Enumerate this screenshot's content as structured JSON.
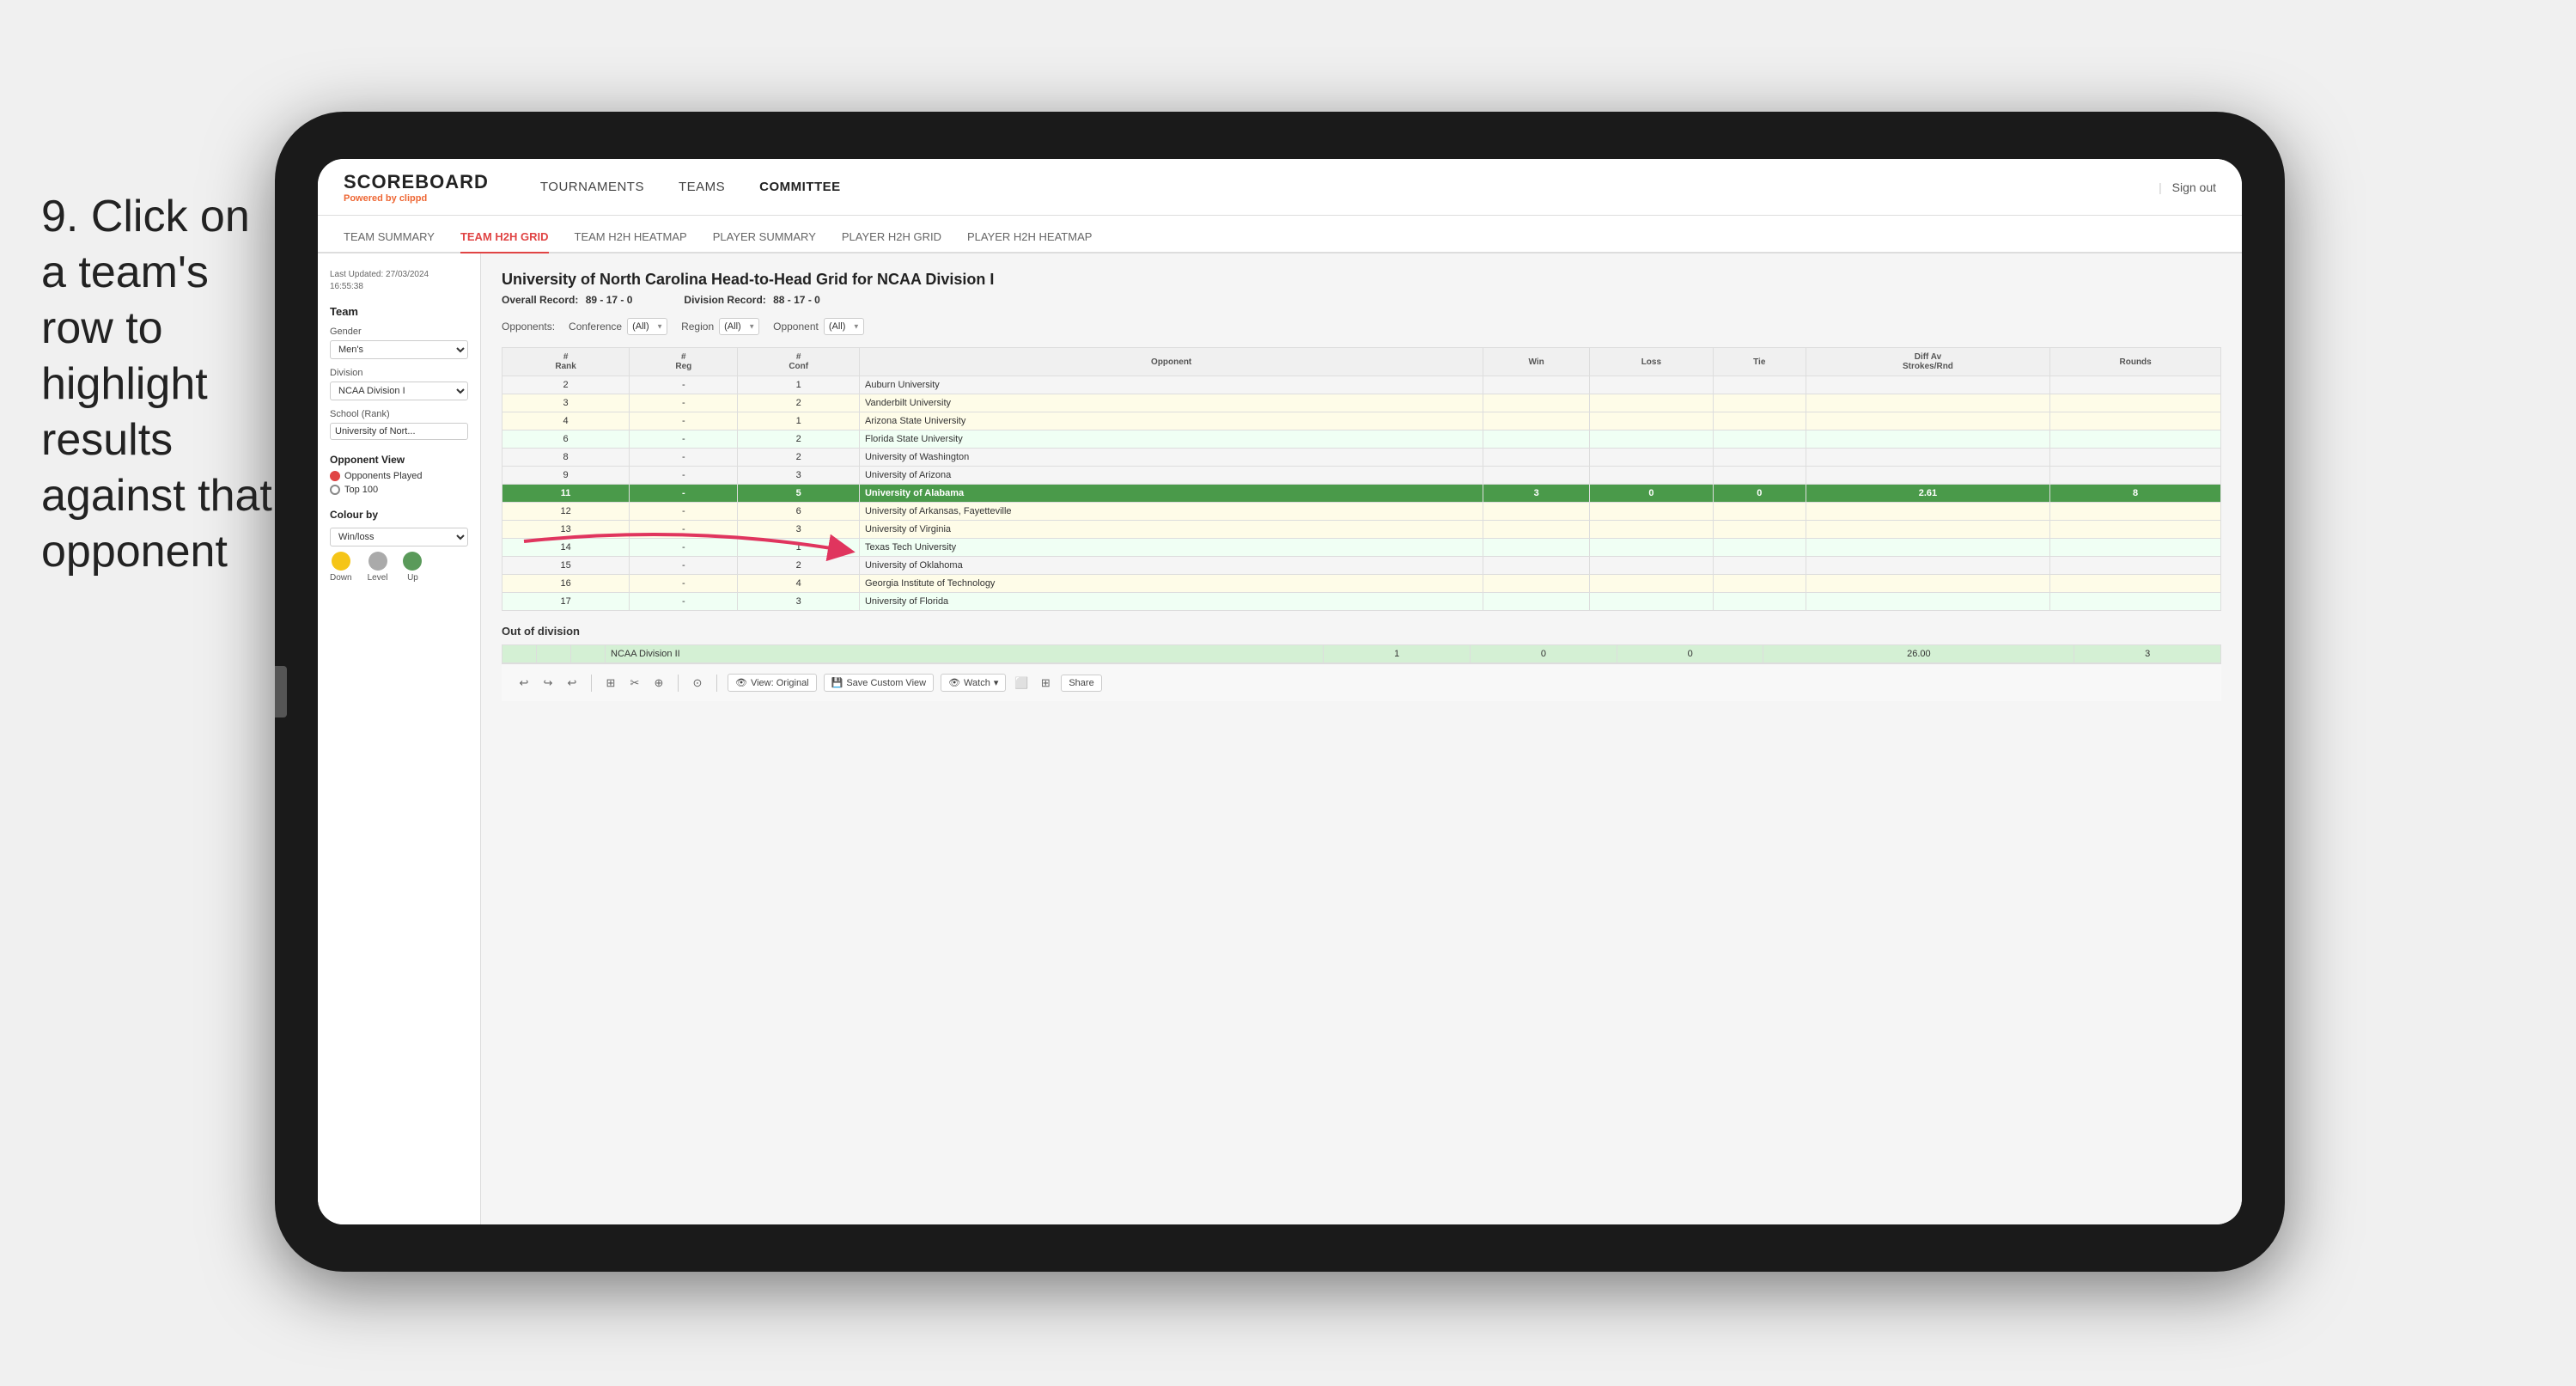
{
  "instruction": {
    "step": "9.",
    "text": "Click on a team's row to highlight results against that opponent"
  },
  "app": {
    "logo": "SCOREBOARD",
    "logo_sub": "Powered by",
    "logo_brand": "clippd",
    "nav_links": [
      "TOURNAMENTS",
      "TEAMS",
      "COMMITTEE"
    ],
    "sign_out": "Sign out"
  },
  "sub_tabs": [
    "TEAM SUMMARY",
    "TEAM H2H GRID",
    "TEAM H2H HEATMAP",
    "PLAYER SUMMARY",
    "PLAYER H2H GRID",
    "PLAYER H2H HEATMAP"
  ],
  "active_sub_tab": "TEAM H2H GRID",
  "sidebar": {
    "timestamp_label": "Last Updated: 27/03/2024",
    "timestamp_time": "16:55:38",
    "team_label": "Team",
    "gender_label": "Gender",
    "gender_value": "Men's",
    "division_label": "Division",
    "division_value": "NCAA Division I",
    "school_label": "School (Rank)",
    "school_value": "University of Nort...",
    "opponent_view_label": "Opponent View",
    "opponents_played_label": "Opponents Played",
    "top100_label": "Top 100",
    "colour_by_label": "Colour by",
    "colour_by_value": "Win/loss",
    "legend": [
      {
        "label": "Down",
        "color": "yellow"
      },
      {
        "label": "Level",
        "color": "gray"
      },
      {
        "label": "Up",
        "color": "green"
      }
    ]
  },
  "panel": {
    "title": "University of North Carolina Head-to-Head Grid for NCAA Division I",
    "overall_record_label": "Overall Record:",
    "overall_record": "89 - 17 - 0",
    "division_record_label": "Division Record:",
    "division_record": "88 - 17 - 0",
    "filters": {
      "opponents_label": "Opponents:",
      "conference_label": "Conference",
      "conference_value": "(All)",
      "region_label": "Region",
      "region_value": "(All)",
      "opponent_label": "Opponent",
      "opponent_value": "(All)"
    },
    "table_headers": [
      "#\nRank",
      "#\nReg",
      "#\nConf",
      "Opponent",
      "Win",
      "Loss",
      "Tie",
      "Diff Av\nStrokes/Rnd",
      "Rounds"
    ],
    "rows": [
      {
        "rank": "2",
        "reg": "-",
        "conf": "1",
        "opponent": "Auburn University",
        "win": "",
        "loss": "",
        "tie": "",
        "diff": "",
        "rounds": "",
        "style": "plain"
      },
      {
        "rank": "3",
        "reg": "-",
        "conf": "2",
        "opponent": "Vanderbilt University",
        "win": "",
        "loss": "",
        "tie": "",
        "diff": "",
        "rounds": "",
        "style": "light-yellow"
      },
      {
        "rank": "4",
        "reg": "-",
        "conf": "1",
        "opponent": "Arizona State University",
        "win": "",
        "loss": "",
        "tie": "",
        "diff": "",
        "rounds": "",
        "style": "light-yellow"
      },
      {
        "rank": "6",
        "reg": "-",
        "conf": "2",
        "opponent": "Florida State University",
        "win": "",
        "loss": "",
        "tie": "",
        "diff": "",
        "rounds": "",
        "style": "light-green"
      },
      {
        "rank": "8",
        "reg": "-",
        "conf": "2",
        "opponent": "University of Washington",
        "win": "",
        "loss": "",
        "tie": "",
        "diff": "",
        "rounds": "",
        "style": "plain"
      },
      {
        "rank": "9",
        "reg": "-",
        "conf": "3",
        "opponent": "University of Arizona",
        "win": "",
        "loss": "",
        "tie": "",
        "diff": "",
        "rounds": "",
        "style": "plain"
      },
      {
        "rank": "11",
        "reg": "-",
        "conf": "5",
        "opponent": "University of Alabama",
        "win": "3",
        "loss": "0",
        "tie": "0",
        "diff": "2.61",
        "rounds": "8",
        "style": "highlighted"
      },
      {
        "rank": "12",
        "reg": "-",
        "conf": "6",
        "opponent": "University of Arkansas, Fayetteville",
        "win": "",
        "loss": "",
        "tie": "",
        "diff": "",
        "rounds": "",
        "style": "light-yellow"
      },
      {
        "rank": "13",
        "reg": "-",
        "conf": "3",
        "opponent": "University of Virginia",
        "win": "",
        "loss": "",
        "tie": "",
        "diff": "",
        "rounds": "",
        "style": "light-yellow"
      },
      {
        "rank": "14",
        "reg": "-",
        "conf": "1",
        "opponent": "Texas Tech University",
        "win": "",
        "loss": "",
        "tie": "",
        "diff": "",
        "rounds": "",
        "style": "light-green"
      },
      {
        "rank": "15",
        "reg": "-",
        "conf": "2",
        "opponent": "University of Oklahoma",
        "win": "",
        "loss": "",
        "tie": "",
        "diff": "",
        "rounds": "",
        "style": "plain"
      },
      {
        "rank": "16",
        "reg": "-",
        "conf": "4",
        "opponent": "Georgia Institute of Technology",
        "win": "",
        "loss": "",
        "tie": "",
        "diff": "",
        "rounds": "",
        "style": "light-yellow"
      },
      {
        "rank": "17",
        "reg": "-",
        "conf": "3",
        "opponent": "University of Florida",
        "win": "",
        "loss": "",
        "tie": "",
        "diff": "",
        "rounds": "",
        "style": "light-green"
      }
    ],
    "out_of_division_label": "Out of division",
    "out_of_division_row": {
      "division": "NCAA Division II",
      "win": "1",
      "loss": "0",
      "tie": "0",
      "diff": "26.00",
      "rounds": "3"
    }
  },
  "toolbar": {
    "view_original": "View: Original",
    "save_custom_view": "Save Custom View",
    "watch": "Watch",
    "share": "Share"
  }
}
